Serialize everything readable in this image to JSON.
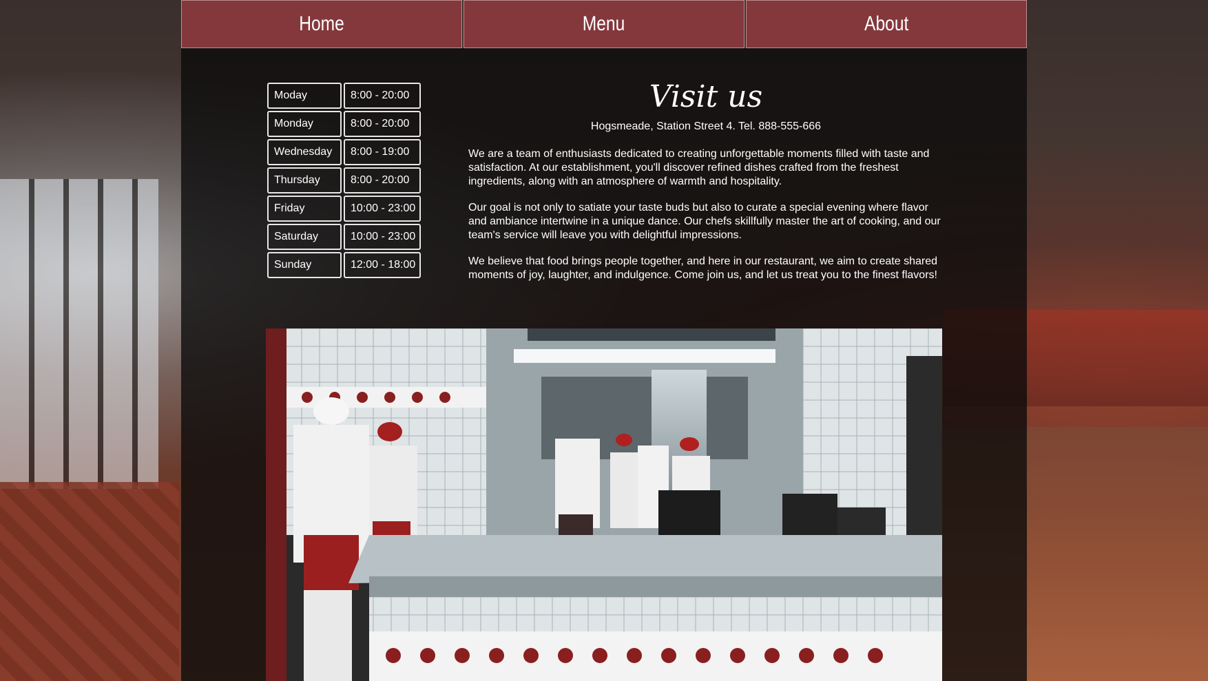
{
  "nav": {
    "items": [
      {
        "label": "Home"
      },
      {
        "label": "Menu"
      },
      {
        "label": "About"
      }
    ]
  },
  "hours": [
    {
      "day": "Moday",
      "time": "8:00 - 20:00"
    },
    {
      "day": "Monday",
      "time": "8:00 - 20:00"
    },
    {
      "day": "Wednesday",
      "time": "8:00 - 19:00"
    },
    {
      "day": "Thursday",
      "time": "8:00 - 20:00"
    },
    {
      "day": "Friday",
      "time": "10:00 - 23:00"
    },
    {
      "day": "Saturday",
      "time": "10:00 - 23:00"
    },
    {
      "day": "Sunday",
      "time": "12:00 - 18:00"
    }
  ],
  "visit": {
    "title": "Visit us",
    "address": "Hogsmeade, Station Street 4. Tel. 888-555-666",
    "paragraphs": [
      "We are a team of enthusiasts dedicated to creating unforgettable moments filled with taste and satisfaction. At our establishment, you'll discover refined dishes crafted from the freshest ingredients, along with an atmosphere of warmth and hospitality.",
      "Our goal is not only to satiate your taste buds but also to curate a special evening where flavor and ambiance intertwine in a unique dance. Our chefs skillfully master the art of cooking, and our team's service will leave you with delightful impressions.",
      "We believe that food brings people together, and here in our restaurant, we aim to create shared moments of joy, laughter, and indulgence. Come join us, and let us treat you to the finest flavors!"
    ]
  },
  "colors": {
    "nav_background": "#8c3a3e",
    "panel_background": "#0a0a0a",
    "text": "#ffffff"
  }
}
